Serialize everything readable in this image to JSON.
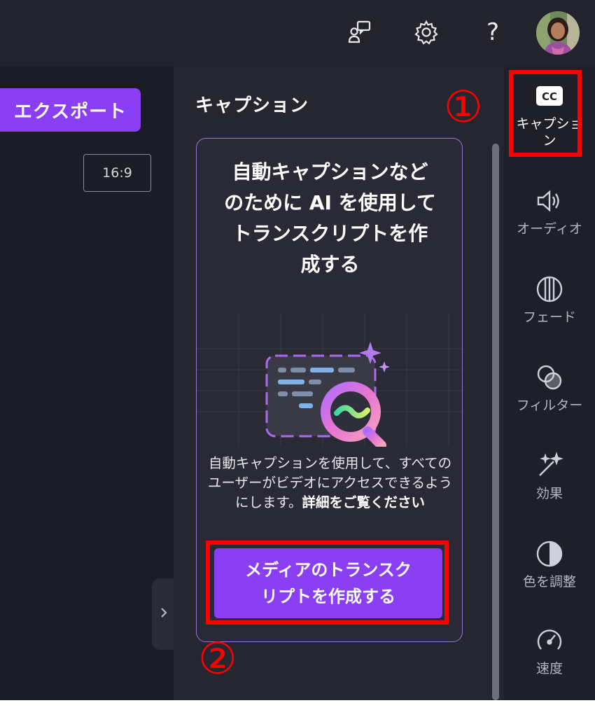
{
  "topbar": {
    "icons": {
      "feedback": "feedback-icon",
      "settings": "gear-icon",
      "help": "?"
    },
    "avatar": "avatar"
  },
  "editor": {
    "export_label": "エクスポート",
    "aspect_ratio": "16:9",
    "collapse_icon": "chevron-right-icon"
  },
  "caption_panel": {
    "title": "キャプション",
    "card": {
      "heading_lines": [
        "自動キャプションなど",
        "のために AI を使用して",
        "トランスクリプトを作",
        "成する"
      ],
      "description": "自動キャプションを使用して、すべてのユーザーがビデオにアクセスできるようにします。",
      "learn_more": "詳細をご覧ください",
      "button_lines": [
        "メディアのトランスク",
        "リプトを作成する"
      ]
    }
  },
  "rail": {
    "items": [
      {
        "label_lines": [
          "キャプショ",
          "ン"
        ],
        "icon": "cc-icon"
      },
      {
        "label_lines": [
          "オーディオ"
        ],
        "icon": "speaker-icon"
      },
      {
        "label_lines": [
          "フェード"
        ],
        "icon": "fade-icon"
      },
      {
        "label_lines": [
          "フィルター"
        ],
        "icon": "filter-icon"
      },
      {
        "label_lines": [
          "効果"
        ],
        "icon": "magic-wand-icon"
      },
      {
        "label_lines": [
          "色を調整"
        ],
        "icon": "contrast-icon"
      },
      {
        "label_lines": [
          "速度"
        ],
        "icon": "speedometer-icon"
      }
    ]
  },
  "annotations": {
    "marker_1": "①",
    "marker_2": "②",
    "color": "#ff0000"
  },
  "colors": {
    "accent": "#8b3ff5",
    "panel_bg": "#262631",
    "app_bg": "#1c1c26"
  }
}
